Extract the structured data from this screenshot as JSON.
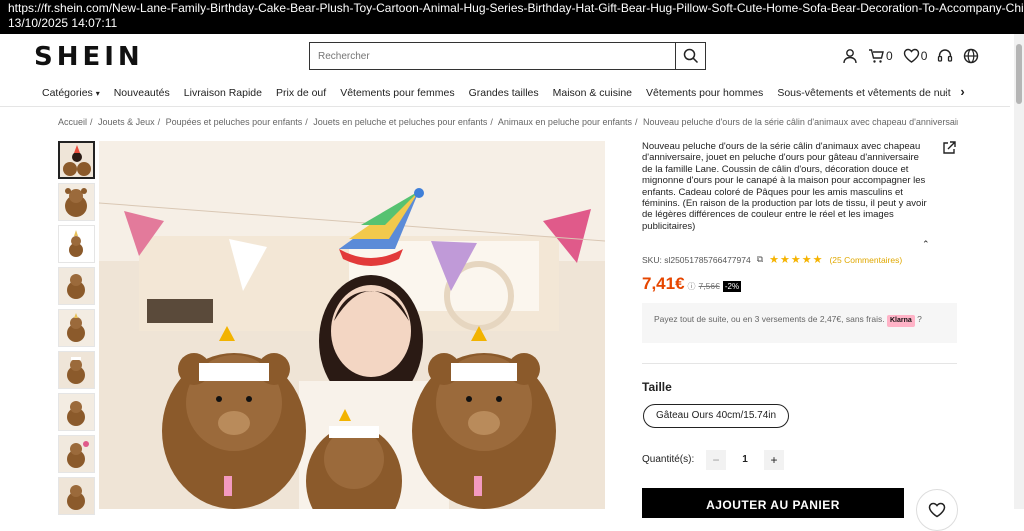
{
  "browser": {
    "url": "https://fr.shein.com/New-Lane-Family-Birthday-Cake-Bear-Plush-Toy-Cartoon-Animal-Hug-Series-Birthday-Hat-Gift-Bear-Hug-Pillow-Soft-Cute-Home-Sofa-Bear-Decoration-To-Accompany-Chi",
    "timestamp": "13/10/2025  14:07:11"
  },
  "header": {
    "logo": "SHEIN",
    "search_placeholder": "Rechercher",
    "cart_count": "0",
    "wishlist_count": "0"
  },
  "nav": {
    "items": [
      "Catégories",
      "Nouveautés",
      "Livraison Rapide",
      "Prix de ouf",
      "Vêtements pour femmes",
      "Grandes tailles",
      "Maison & cuisine",
      "Vêtements pour hommes",
      "Sous-vêtements et vêtements de nuit"
    ]
  },
  "breadcrumb": [
    "Accueil",
    "Jouets & Jeux",
    "Poupées et peluches pour enfants",
    "Jouets en peluche et peluches pour enfants",
    "Animaux en peluche pour enfants",
    "Nouveau peluche d'ours de la série câlin d'animaux avec chapeau d'anniversair..."
  ],
  "product": {
    "title": "Nouveau peluche d'ours de la série câlin d'animaux avec chapeau d'anniversaire, jouet en peluche d'ours pour gâteau d'anniversaire de la famille Lane. Coussin de câlin d'ours, décoration douce et mignonne d'ours pour le canapé à la maison pour accompagner les enfants. Cadeau coloré de Pâques pour les amis masculins et féminins. (En raison de la production par lots de tissu, il peut y avoir de légères différences de couleur entre le réel et les images publicitaires)",
    "sku": "SKU: sl2505178576​6477974",
    "stars": "★★★★★",
    "reviews": "(25 Commentaires)",
    "price": "7,41€",
    "old_price": "7,56€",
    "discount": "-2%",
    "klarna_text": "Payez tout de suite, ou en 3 versements de 2,47€, sans frais.",
    "klarna_badge": "Klarna",
    "size_label": "Taille",
    "size_option": "Gâteau Ours 40cm/15.74in",
    "qty_label": "Quantité(s):",
    "qty_value": "1",
    "add_to_cart": "AJOUTER AU PANIER"
  },
  "colors": {
    "price": "#e64600",
    "stars": "#f5b301",
    "klarna": "#ffb3c7"
  }
}
